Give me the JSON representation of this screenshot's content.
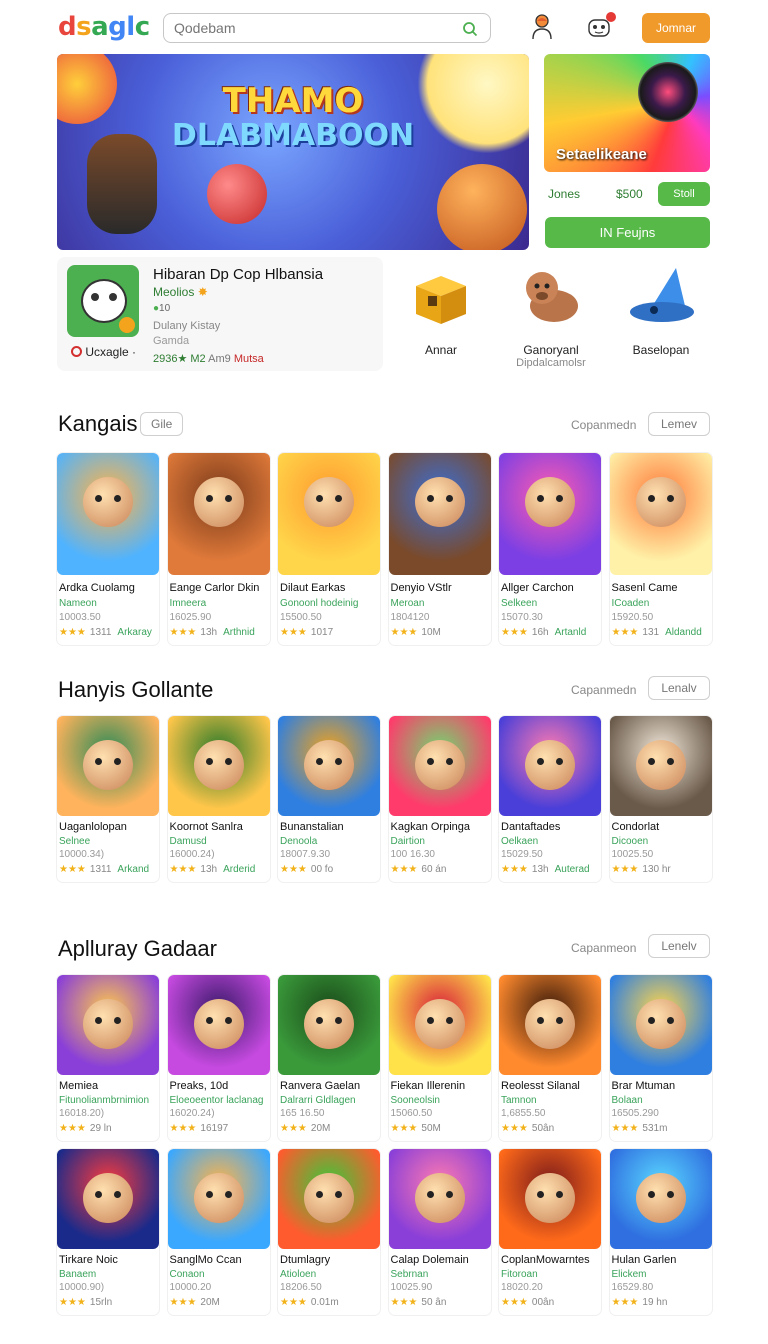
{
  "header": {
    "logo": [
      "d",
      "s",
      "a",
      "gl",
      "c"
    ],
    "search_placeholder": "Qodebam",
    "join_label": "Jomnar"
  },
  "hero": {
    "title_line1": "THAMO",
    "title_line2": "DLABMABOON"
  },
  "side_banner": {
    "label": "Setaelikeane"
  },
  "promo": {
    "left": "Jones",
    "price": "$500",
    "button": "Stoll"
  },
  "big_button": "IN Feujns",
  "featured": {
    "title": "Hibaran Dp Cop Hlbansia",
    "subtitle": "Meolios",
    "rating": "10",
    "dev": "Dulany Kistay",
    "genre": "Gamda",
    "stats_a": "2936★ M2",
    "stats_b": "Am9",
    "stats_c": "Mutsa",
    "footer": "Ucxagle"
  },
  "minis": [
    {
      "label": "Annar",
      "sub": ""
    },
    {
      "label": "Ganoryanl",
      "sub": "Dipdalcamolsr"
    },
    {
      "label": "Baselopan",
      "sub": ""
    }
  ],
  "sections": [
    {
      "title": "Kangais",
      "pill": "Gile",
      "link": "Copanmedn",
      "more": "Lemev",
      "cards": [
        {
          "name": "Ardka Cuolamg",
          "dev": "Nameon",
          "nums": "10003.50",
          "rating": "1311",
          "tag": "Arkaray"
        },
        {
          "name": "Eange Carlor Dkin",
          "dev": "Imneera",
          "nums": "16025.90",
          "rating": "13h",
          "tag": "Arthnid"
        },
        {
          "name": "Dilaut Earkas",
          "dev": "Gonoonl hodeinig",
          "nums": "15500.50",
          "rating": "1017",
          "tag": ""
        },
        {
          "name": "Denyio VStlr",
          "dev": "Meroan",
          "nums": "1804120",
          "rating": "10M",
          "tag": ""
        },
        {
          "name": "Allger Carchon",
          "dev": "Selkeen",
          "nums": "15070.30",
          "rating": "16h",
          "tag": "Artanld"
        },
        {
          "name": "Sasenl Came",
          "dev": "ICoaden",
          "nums": "15920.50",
          "rating": "131",
          "tag": "Aldandd"
        }
      ]
    },
    {
      "title": "Hanyis Gollante",
      "pill": "",
      "link": "Capanmedn",
      "more": "Lenalv",
      "cards": [
        {
          "name": "Uaganlolopan",
          "dev": "Selnee",
          "nums": "10000.34)",
          "rating": "1311",
          "tag": "Arkand"
        },
        {
          "name": "Koornot Sanlra",
          "dev": "Damusd",
          "nums": "16000.24)",
          "rating": "13h",
          "tag": "Arderid"
        },
        {
          "name": "Bunanstalian",
          "dev": "Denoola",
          "nums": "18007.9.30",
          "rating": "00 fo",
          "tag": ""
        },
        {
          "name": "Kagkan Orpinga",
          "dev": "Dairtion",
          "nums": "100 16.30",
          "rating": "60 án",
          "tag": ""
        },
        {
          "name": "Dantaftades",
          "dev": "Oelkaen",
          "nums": "15029.50",
          "rating": "13h",
          "tag": "Auterad"
        },
        {
          "name": "Condorlat",
          "dev": "Dicooen",
          "nums": "10025.50",
          "rating": "130 hr",
          "tag": ""
        }
      ]
    },
    {
      "title": "Aplluray Gadaar",
      "pill": "",
      "link": "Capanmeon",
      "more": "Lenelv",
      "cards": [
        {
          "name": "Memiea",
          "dev": "Fitunolianmbrnimion",
          "nums": "16018.20)",
          "rating": "29 ln",
          "tag": ""
        },
        {
          "name": "Preaks, 10d",
          "dev": "Eloeoeentor laclanag",
          "nums": "16020.24)",
          "rating": "16197",
          "tag": ""
        },
        {
          "name": "Ranvera Gaelan",
          "dev": "Dalrarri Gldlagen",
          "nums": "165 16.50",
          "rating": "20M",
          "tag": ""
        },
        {
          "name": "Fiekan Illerenin",
          "dev": "Sooneolsin",
          "nums": "15060.50",
          "rating": "50M",
          "tag": ""
        },
        {
          "name": "Reolesst Silanal",
          "dev": "Tamnon",
          "nums": "1,6855.50",
          "rating": "50ân",
          "tag": ""
        },
        {
          "name": "Brar Mtuman",
          "dev": "Bolaan",
          "nums": "16505.290",
          "rating": "531m",
          "tag": ""
        },
        {
          "name": "Tirkare Noic",
          "dev": "Banaem",
          "nums": "10000.90)",
          "rating": "15rln",
          "tag": ""
        },
        {
          "name": "SanglMo Ccan",
          "dev": "Conaon",
          "nums": "10000.20",
          "rating": "20M",
          "tag": ""
        },
        {
          "name": "Dtumlagry",
          "dev": "Atioloen",
          "nums": "18206.50",
          "rating": "0.01m",
          "tag": ""
        },
        {
          "name": "Calap Dolemain",
          "dev": "Sebrnan",
          "nums": "10025.90",
          "rating": "50 ân",
          "tag": ""
        },
        {
          "name": "CoplanMowarntes",
          "dev": "Fitoroan",
          "nums": "18020.20",
          "rating": "00ân",
          "tag": ""
        },
        {
          "name": "Hulan Garlen",
          "dev": "Elickem",
          "nums": "16529.80",
          "rating": "19 hn",
          "tag": ""
        }
      ]
    }
  ]
}
